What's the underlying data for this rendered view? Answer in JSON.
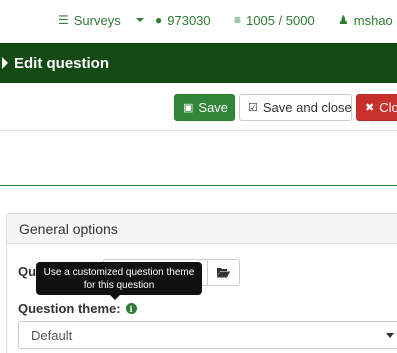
{
  "topnav": {
    "surveys_label": "Surveys",
    "comments_count": "973030",
    "storage_label": "1005 / 5000",
    "user_name": "mshao"
  },
  "titlebar": {
    "title": "Edit question"
  },
  "actions": {
    "save_label": "Save",
    "save_close_label": "Save and close",
    "close_label": "Clo"
  },
  "panel": {
    "title": "General options",
    "question_label_visible": "Qu",
    "tooltip": "Use a customized question theme for this question",
    "theme_label": "Question theme:",
    "theme_value": "Default"
  },
  "colors": {
    "brand_green": "#144b14",
    "accent_green": "#328637",
    "danger_red": "#c9302c"
  },
  "icons": {
    "surveys": "list-icon",
    "comments": "comments-icon",
    "storage": "database-icon",
    "user": "user-icon",
    "save": "save-icon",
    "save_close": "check-square-icon",
    "close": "close-icon",
    "folder": "folder-open-icon",
    "info": "info-icon"
  }
}
